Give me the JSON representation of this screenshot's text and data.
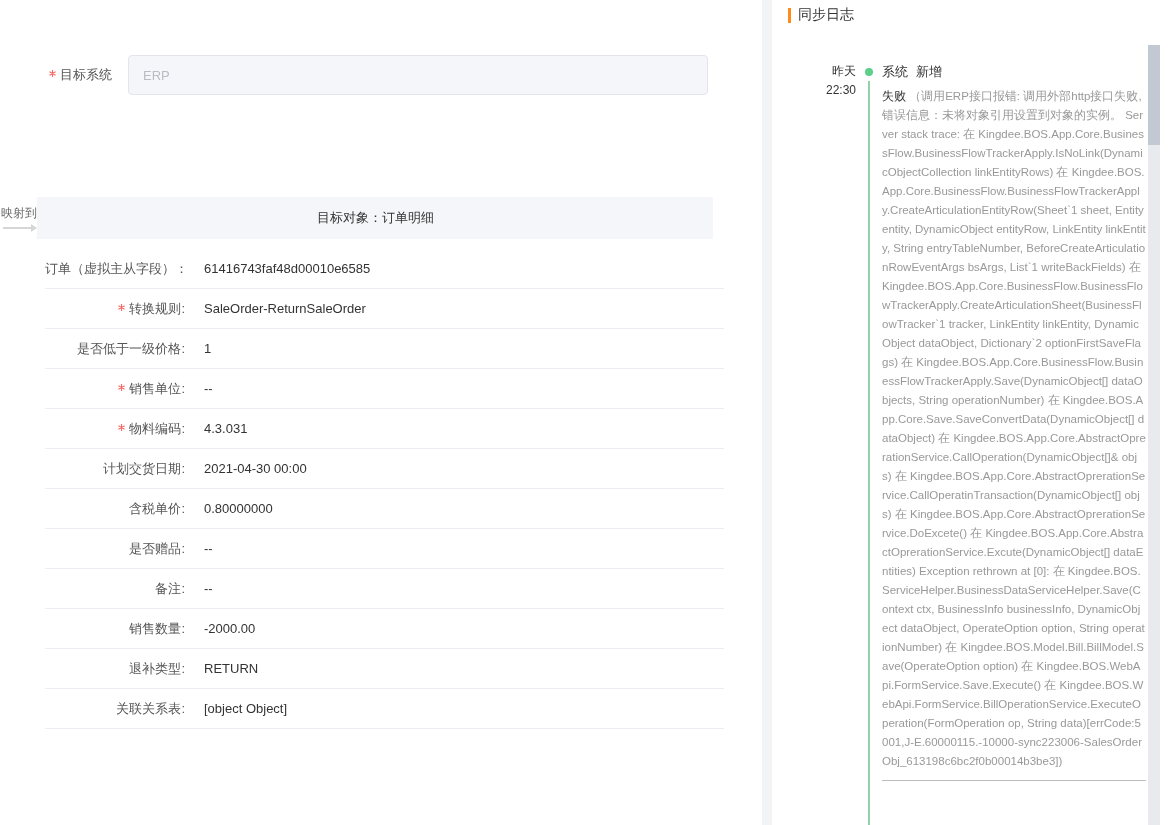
{
  "form": {
    "target_system": {
      "label": "目标系统",
      "required": true,
      "placeholder": "ERP"
    }
  },
  "mapping": {
    "arrow_label": "映射到",
    "header": "目标对象：订单明细",
    "rows": [
      {
        "label": "订单（虚拟主从字段）：",
        "value": "61416743faf48d00010e6585",
        "required": false
      },
      {
        "label": "转换规则:",
        "value": "SaleOrder-ReturnSaleOrder",
        "required": true
      },
      {
        "label": "是否低于一级价格:",
        "value": "1",
        "required": false
      },
      {
        "label": "销售单位:",
        "value": "--",
        "required": true
      },
      {
        "label": "物料编码:",
        "value": "4.3.031",
        "required": true
      },
      {
        "label": "计划交货日期:",
        "value": "2021-04-30 00:00",
        "required": false
      },
      {
        "label": "含税单价:",
        "value": "0.80000000",
        "required": false
      },
      {
        "label": "是否赠品:",
        "value": "--",
        "required": false
      },
      {
        "label": "备注:",
        "value": "--",
        "required": false
      },
      {
        "label": "销售数量:",
        "value": "-2000.00",
        "required": false
      },
      {
        "label": "退补类型:",
        "value": "RETURN",
        "required": false
      },
      {
        "label": "关联关系表:",
        "value": "[object Object]",
        "required": false
      }
    ]
  },
  "sync_log": {
    "title": "同步日志",
    "entries": [
      {
        "day": "昨天",
        "time": "22:30",
        "source": "系统",
        "action": "新增",
        "status": "失败",
        "message": "（调用ERP接口报错: 调用外部http接口失败,错误信息：未将对象引用设置到对象的实例。 Server stack trace: 在 Kingdee.BOS.App.Core.BusinessFlow.BusinessFlowTrackerApply.IsNoLink(DynamicObjectCollection linkEntityRows) 在 Kingdee.BOS.App.Core.BusinessFlow.BusinessFlowTrackerApply.CreateArticulationEntityRow(Sheet`1 sheet, Entity entity, DynamicObject entityRow, LinkEntity linkEntity, String entryTableNumber, BeforeCreateArticulationRowEventArgs bsArgs, List`1 writeBackFields) 在 Kingdee.BOS.App.Core.BusinessFlow.BusinessFlowTrackerApply.CreateArticulationSheet(BusinessFlowTracker`1 tracker, LinkEntity linkEntity, DynamicObject dataObject, Dictionary`2 optionFirstSaveFlags) 在 Kingdee.BOS.App.Core.BusinessFlow.BusinessFlowTrackerApply.Save(DynamicObject[] dataObjects, String operationNumber) 在 Kingdee.BOS.App.Core.Save.SaveConvertData(DynamicObject[] dataObject) 在 Kingdee.BOS.App.Core.AbstractOprerationService.CallOperation(DynamicObject[]& objs) 在 Kingdee.BOS.App.Core.AbstractOprerationService.CallOperatinTransaction(DynamicObject[] objs) 在 Kingdee.BOS.App.Core.AbstractOprerationService.DoExcete() 在 Kingdee.BOS.App.Core.AbstractOprerationService.Excute(DynamicObject[] dataEntities) Exception rethrown at [0]: 在 Kingdee.BOS.ServiceHelper.BusinessDataServiceHelper.Save(Context ctx, BusinessInfo businessInfo, DynamicObject dataObject, OperateOption option, String operationNumber) 在 Kingdee.BOS.Model.Bill.BillModel.Save(OperateOption option) 在 Kingdee.BOS.WebApi.FormService.Save.Execute() 在 Kingdee.BOS.WebApi.FormService.BillOperationService.ExecuteOperation(FormOperation op, String data)[errCode:5001,J-E.60000115.-10000-sync223006-SalesOrderObj_613198c6bc2f0b00014b3be3])"
      }
    ]
  }
}
